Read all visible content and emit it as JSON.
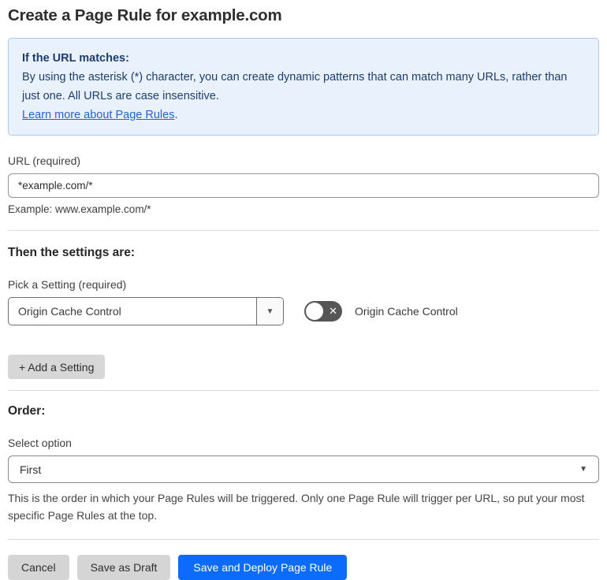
{
  "page": {
    "title": "Create a Page Rule for example.com"
  },
  "info_box": {
    "heading": "If the URL matches:",
    "body": "By using the asterisk (*) character, you can create dynamic patterns that can match many URLs, rather than just one. All URLs are case insensitive.",
    "link_label": "Learn more about Page Rules",
    "link_suffix": "."
  },
  "url_field": {
    "label": "URL (required)",
    "value": "*example.com/*",
    "example": "Example: www.example.com/*"
  },
  "settings_section": {
    "heading": "Then the settings are:",
    "pick_label": "Pick a Setting (required)",
    "selected_setting": "Origin Cache Control",
    "toggle_label": "Origin Cache Control",
    "toggle_state": "off",
    "add_setting_label": "+ Add a Setting"
  },
  "order_section": {
    "heading": "Order:",
    "select_label": "Select option",
    "selected_option": "First",
    "help_text": "This is the order in which your Page Rules will be triggered. Only one Page Rule will trigger per URL, so put your most specific Page Rules at the top."
  },
  "footer": {
    "cancel_label": "Cancel",
    "save_draft_label": "Save as Draft",
    "save_deploy_label": "Save and Deploy Page Rule"
  },
  "icons": {
    "caret_down": "▼",
    "toggle_off_x": "✕"
  },
  "colors": {
    "accent_blue": "#0b6cfb",
    "info_bg": "#e9f2fc",
    "info_border": "#a9c9ef",
    "info_text": "#1d3d6e",
    "link_blue": "#1f64d6"
  }
}
